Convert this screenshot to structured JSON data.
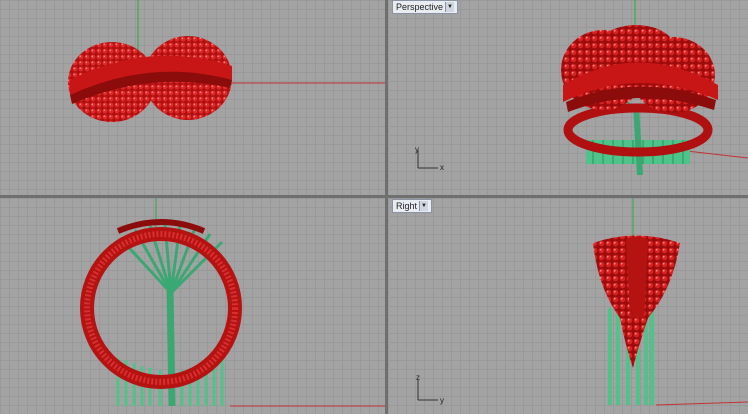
{
  "viewports": {
    "top": {
      "title": ""
    },
    "perspective": {
      "title": "Perspective"
    },
    "front": {
      "title": ""
    },
    "right": {
      "title": "Right"
    }
  },
  "axis_labels": {
    "persp_y": "y",
    "persp_x": "x",
    "right_z": "z",
    "right_y": "y"
  },
  "colors": {
    "ring": "#c81515",
    "ring_dark": "#7a0a0a",
    "support": "#4fc48a",
    "grid_bg": "#a3a3a3",
    "grid_line": "#999999",
    "x_axis": "#c23333",
    "y_axis": "#2fa84a"
  },
  "icons": {
    "dropdown": "chevron-down-icon"
  }
}
